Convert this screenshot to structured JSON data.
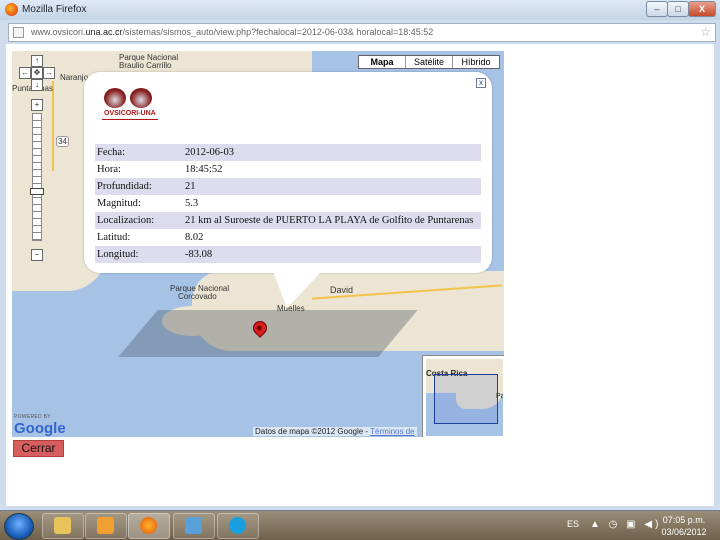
{
  "window": {
    "title": "Mozilla Firefox",
    "min_glyph": "–",
    "max_glyph": "□",
    "close_glyph": "X"
  },
  "address": {
    "url_prefix": "www.ovsicori.",
    "url_domain": "una.ac.cr",
    "url_rest": "/sistemas/sismos_auto/view.php?fechalocal=2012-06-03& horalocal=18:45:52"
  },
  "map": {
    "types": [
      "Mapa",
      "Satélite",
      "Híbrido"
    ],
    "active_type": "Mapa",
    "labels": {
      "parque_nacional_top": "Parque Nacional",
      "braulio": "Braulio Carrillo",
      "naranjo": "Naranjo",
      "puntarenas": "Puntarenas",
      "route34": "34",
      "parque_corcovado": "Parque Nacional",
      "corcovado": "Corcovado",
      "david": "David",
      "muelles": "Muelles",
      "overview_country": "Costa Rica",
      "overview_pa": "Pa"
    },
    "powered_by": "POWERED BY",
    "google": "Google",
    "copyright": "Datos de mapa ©2012 Google - ",
    "terms": "Términos de"
  },
  "infowindow": {
    "logo_text": "OVSICORI-UNA",
    "close_glyph": "x",
    "rows": [
      {
        "key": "Fecha:",
        "value": "2012-06-03"
      },
      {
        "key": "Hora:",
        "value": "18:45:52"
      },
      {
        "key": "Profundidad:",
        "value": "21"
      },
      {
        "key": "Magnitud:",
        "value": "5.3"
      },
      {
        "key": "Localizacion:",
        "value": "21 km al Suroeste de PUERTO LA PLAYA de Golfito de Puntarenas"
      },
      {
        "key": "Latitud:",
        "value": "8.02"
      },
      {
        "key": "Longitud:",
        "value": "-83.08"
      }
    ]
  },
  "cerrar_label": "Cerrar",
  "taskbar": {
    "language": "ES",
    "clock_time": "07:05 p.m.",
    "clock_date": "03/06/2012"
  },
  "colors": {
    "map_water": "#a6c3e6",
    "land": "#ece5d3",
    "road": "#f2c34a",
    "table_alt_row": "#dcdcee",
    "close_button": "#d65e5e",
    "marker": "#d62020"
  }
}
